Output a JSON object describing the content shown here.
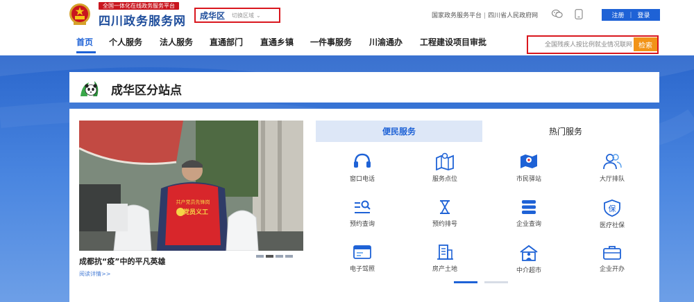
{
  "header": {
    "slogan": "全国一体化在线政务服务平台",
    "site_title": "四川政务服务网",
    "region": {
      "name": "成华区",
      "switch_label": "切换区域"
    },
    "top_links": [
      "国家政务服务平台",
      "四川省人民政府网"
    ],
    "auth": {
      "register": "注册",
      "login": "登录"
    }
  },
  "nav": {
    "items": [
      "首页",
      "个人服务",
      "法人服务",
      "直通部门",
      "直通乡镇",
      "一件事服务",
      "川渝通办",
      "工程建设项目审批"
    ],
    "active_index": 0
  },
  "search": {
    "value": "全国残疾人按比例就业情况联网",
    "button": "检索"
  },
  "station": {
    "title": "成华区分站点"
  },
  "carousel": {
    "caption": "成都抗“疫”中的平凡英雄",
    "read_more": "阅读详情>>",
    "vest_text_top": "共产党员先锋岗",
    "vest_text_bottom": "党员义工",
    "slide_count": 4,
    "active_slide": 1
  },
  "tabs": [
    "便民服务",
    "热门服务"
  ],
  "services": [
    {
      "label": "窗口电话",
      "icon": "headset-icon"
    },
    {
      "label": "服务点位",
      "icon": "map-location-icon"
    },
    {
      "label": "市民驿站",
      "icon": "station-map-icon"
    },
    {
      "label": "大厅排队",
      "icon": "people-queue-icon"
    },
    {
      "label": "预约查询",
      "icon": "search-list-icon"
    },
    {
      "label": "预约排号",
      "icon": "hourglass-icon"
    },
    {
      "label": "企业查询",
      "icon": "database-icon"
    },
    {
      "label": "医疗社保",
      "icon": "shield-bao-icon"
    },
    {
      "label": "电子驾照",
      "icon": "id-card-icon"
    },
    {
      "label": "房产土地",
      "icon": "building-icon"
    },
    {
      "label": "中介超市",
      "icon": "house-person-icon"
    },
    {
      "label": "企业开办",
      "icon": "briefcase-icon"
    }
  ],
  "colors": {
    "brand_blue": "#1e62d6",
    "accent_red": "#d9161d",
    "search_orange": "#f29317"
  }
}
